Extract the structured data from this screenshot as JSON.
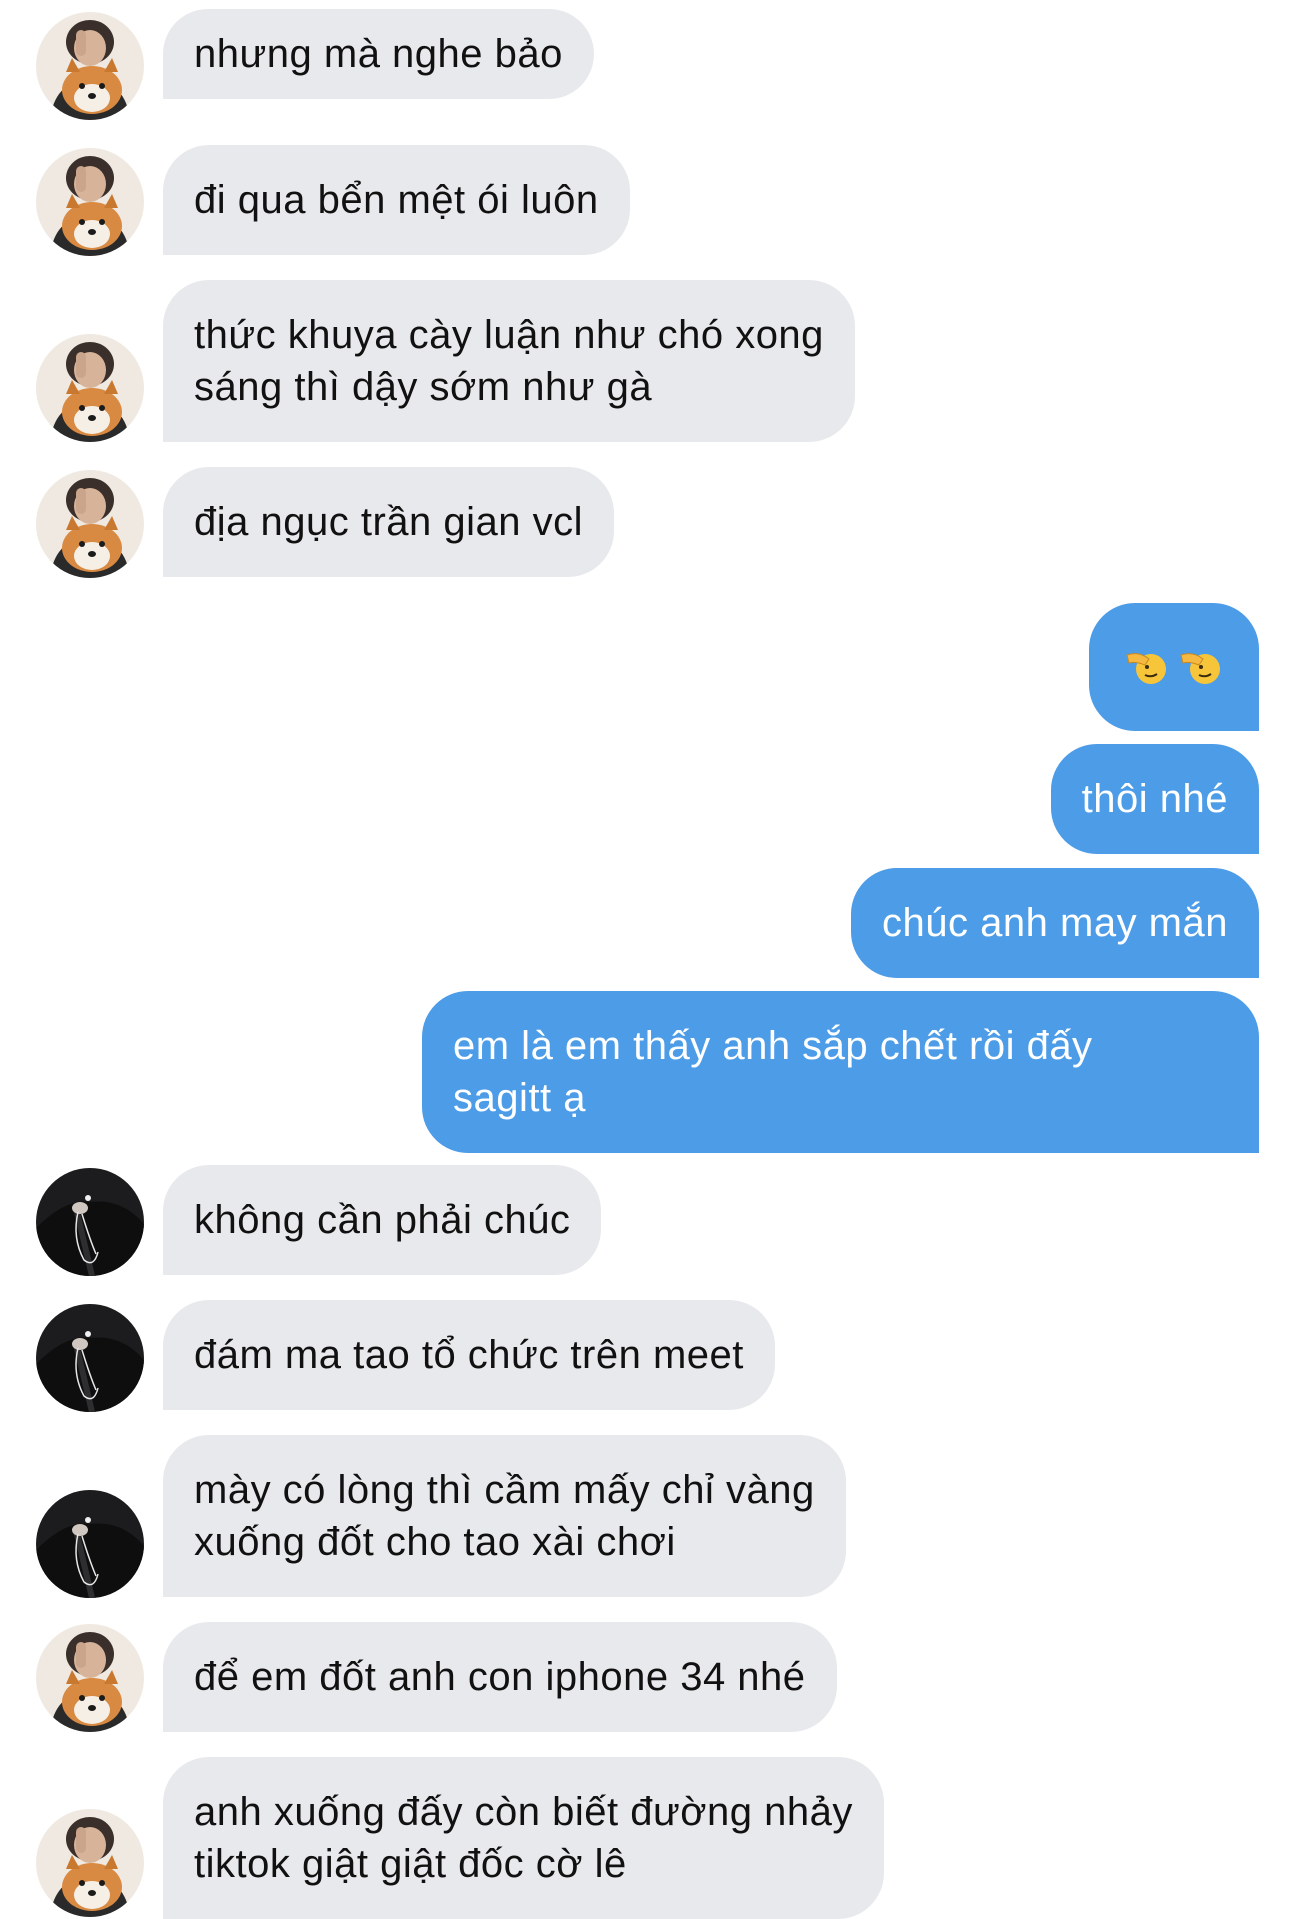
{
  "messages": [
    {
      "from": "them",
      "avatar": "shiba-avatar",
      "text": "nhưng mà nghe bảo"
    },
    {
      "from": "them",
      "avatar": "shiba-avatar",
      "text": "đi qua bển mệt ói luôn"
    },
    {
      "from": "them",
      "avatar": "shiba-avatar",
      "text": "thức khuya cày luận như chó xong\nsáng thì dậy sớm như gà"
    },
    {
      "from": "them",
      "avatar": "shiba-avatar",
      "text": "địa ngục trần gian vcl"
    },
    {
      "from": "me",
      "emoji": [
        "saluting-face-icon",
        "saluting-face-icon"
      ]
    },
    {
      "from": "me",
      "text": "thôi nhé"
    },
    {
      "from": "me",
      "text": "chúc anh may mắn"
    },
    {
      "from": "me",
      "text": "em là em thấy anh sắp chết rồi đấy\nsagitt ạ"
    },
    {
      "from": "them",
      "avatar": "dark-jacket-avatar",
      "text": "không cần phải chúc"
    },
    {
      "from": "them",
      "avatar": "dark-jacket-avatar",
      "text": "đám ma tao tổ chức trên meet"
    },
    {
      "from": "them",
      "avatar": "dark-jacket-avatar",
      "text": "mày có lòng thì cầm mấy chỉ vàng\nxuống đốt cho tao xài chơi"
    },
    {
      "from": "them",
      "avatar": "shiba-avatar",
      "text": "để em đốt anh con iphone 34 nhé"
    },
    {
      "from": "them",
      "avatar": "shiba-avatar",
      "text": "anh xuống đấy còn biết đường nhảy\ntiktok giật giật đốc cờ lê"
    }
  ],
  "colors": {
    "incoming_bubble": "#e8e9ec",
    "outgoing_bubble": "#4c9ce7",
    "incoming_text": "#111111",
    "outgoing_text": "#ffffff"
  }
}
